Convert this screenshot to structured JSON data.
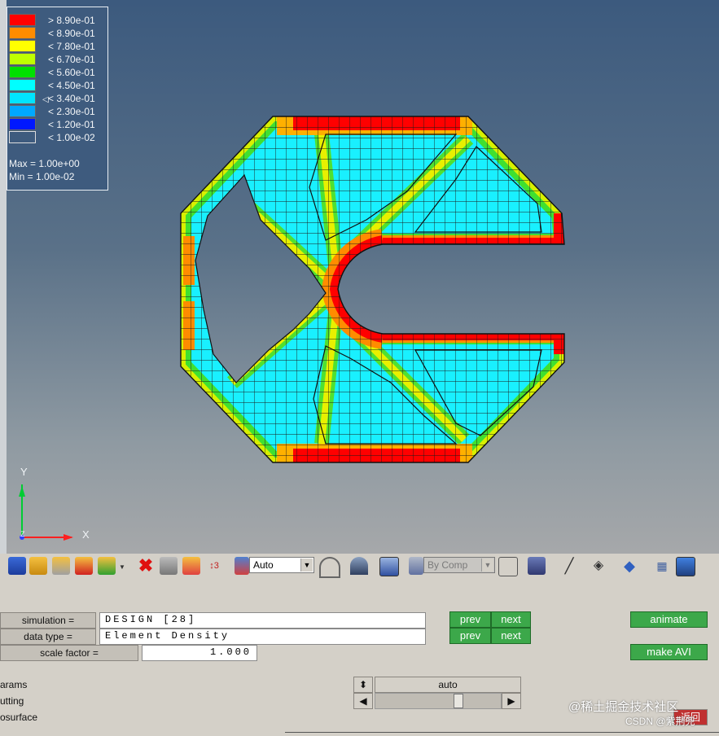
{
  "legend": {
    "entries": [
      {
        "color": "#ff0000",
        "label": "> 8.90e-01"
      },
      {
        "color": "#ff8c00",
        "label": "< 8.90e-01"
      },
      {
        "color": "#ffff00",
        "label": "< 7.80e-01"
      },
      {
        "color": "#bfff00",
        "label": "< 6.70e-01"
      },
      {
        "color": "#00e000",
        "label": "< 5.60e-01"
      },
      {
        "color": "#00ffff",
        "label": "< 4.50e-01"
      },
      {
        "color": "#00e4ff",
        "label": "< 3.40e-01"
      },
      {
        "color": "#00a8ff",
        "label": "< 2.30e-01"
      },
      {
        "color": "#0018ff",
        "label": "< 1.20e-01"
      },
      {
        "color": "#3e5b7e",
        "label": "< 1.00e-02"
      }
    ],
    "max_label": "Max = 1.00e+00",
    "min_label": "Min = 1.00e-02",
    "marker": "◁"
  },
  "axes": {
    "y": "Y",
    "x": "X",
    "z": "Z"
  },
  "toolbar": {
    "auto_select": "Auto",
    "bycomp_select": "By Comp"
  },
  "panel": {
    "simulation_label": "simulation =",
    "simulation_value": "DESIGN [28]",
    "datatype_label": "data type =",
    "datatype_value": "Element Density",
    "scalefactor_label": "scale factor =",
    "scalefactor_value": "1.000",
    "prev": "prev",
    "next": "next",
    "animate": "animate",
    "make_avi": "make AVI",
    "params": "arams",
    "cutting": "utting",
    "isosurface": "osurface",
    "auto": "auto",
    "return": "返回"
  },
  "watermark": {
    "line1": "@稀土掘金技术社区",
    "line2": "CSDN @紫荆兜"
  }
}
